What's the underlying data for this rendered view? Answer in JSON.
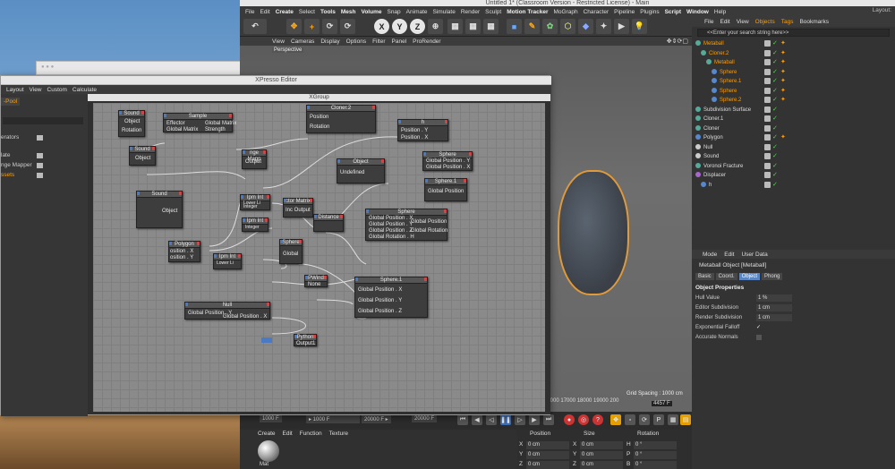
{
  "c4d": {
    "title": "Untitled 1* (Classroom Version - Restricted License) - Main",
    "menu": [
      "File",
      "Edit",
      "Create",
      "Select",
      "Tools",
      "Mesh",
      "Volume",
      "Snap",
      "Animate",
      "Simulate",
      "Render",
      "Sculpt",
      "Motion Tracker",
      "MoGraph",
      "Character",
      "Pipeline",
      "Plugins",
      "Script",
      "Window",
      "Help"
    ],
    "layout_label": "Layout:",
    "toolbar": {
      "x": "X",
      "y": "Y",
      "z": "Z"
    },
    "viewport_menu": [
      "View",
      "Cameras",
      "Display",
      "Options",
      "Filter",
      "Panel",
      "ProRender"
    ],
    "perspective": "Perspective",
    "grid_spacing": "Grid Spacing : 1000 cm",
    "timeline_ticks": "16000 17000 18000 19000 200",
    "timeline_frame": "4457 F",
    "frame_start": "1000 F",
    "frame_cur": "▸ 1000 F",
    "frame_end": "20000 F ▸",
    "frame_max": "20000 F"
  },
  "material": {
    "menu": [
      "Create",
      "Edit",
      "Function",
      "Texture"
    ],
    "label": "Mat"
  },
  "coords": {
    "headers": [
      "Position",
      "Size",
      "Rotation"
    ],
    "rows": [
      {
        "axis": "X",
        "pos": "0 cm",
        "size": "0 cm",
        "rot_axis": "H",
        "rot": "0 °"
      },
      {
        "axis": "Y",
        "pos": "0 cm",
        "size": "0 cm",
        "rot_axis": "P",
        "rot": "0 °"
      },
      {
        "axis": "Z",
        "pos": "0 cm",
        "size": "0 cm",
        "rot_axis": "B",
        "rot": "0 °"
      }
    ]
  },
  "objects": {
    "menu": [
      "File",
      "Edit",
      "View",
      "Objects",
      "Tags",
      "Bookmarks"
    ],
    "search_placeholder": "<<Enter your search string here>>",
    "items": [
      {
        "name": "Metaball",
        "indent": 0,
        "color": "#ff9d00",
        "icon": "#5a9"
      },
      {
        "name": "Cloner.2",
        "indent": 1,
        "color": "#ff9d00",
        "icon": "#5a9"
      },
      {
        "name": "Metaball",
        "indent": 2,
        "color": "#ff9d00",
        "icon": "#5a9"
      },
      {
        "name": "Sphere",
        "indent": 3,
        "color": "#ff9d00",
        "icon": "#58c"
      },
      {
        "name": "Sphere.1",
        "indent": 3,
        "color": "#ff9d00",
        "icon": "#58c"
      },
      {
        "name": "Sphere",
        "indent": 3,
        "color": "#ff9d00",
        "icon": "#58c"
      },
      {
        "name": "Sphere.2",
        "indent": 3,
        "color": "#ff9d00",
        "icon": "#58c"
      },
      {
        "name": "Subdivision Surface",
        "indent": 0,
        "color": "#ddd",
        "icon": "#5a9"
      },
      {
        "name": "Cloner.1",
        "indent": 0,
        "color": "#ddd",
        "icon": "#5a9"
      },
      {
        "name": "Cloner",
        "indent": 0,
        "color": "#ddd",
        "icon": "#5a9"
      },
      {
        "name": "Polygon",
        "indent": 0,
        "color": "#ddd",
        "icon": "#58c"
      },
      {
        "name": "Null",
        "indent": 0,
        "color": "#ddd",
        "icon": "#ccc"
      },
      {
        "name": "Sound",
        "indent": 0,
        "color": "#ddd",
        "icon": "#ccc"
      },
      {
        "name": "Voronoi Fracture",
        "indent": 0,
        "color": "#ddd",
        "icon": "#5a9"
      },
      {
        "name": "Displacer",
        "indent": 0,
        "color": "#ddd",
        "icon": "#a6c"
      },
      {
        "name": "h",
        "indent": 1,
        "color": "#ddd",
        "icon": "#58c"
      }
    ]
  },
  "attributes": {
    "menu": [
      "Mode",
      "Edit",
      "User Data"
    ],
    "title": "Metaball Object [Metaball]",
    "tabs": [
      "Basic",
      "Coord.",
      "Object",
      "Phong"
    ],
    "active_tab": "Object",
    "section": "Object Properties",
    "props": [
      {
        "label": "Hull Value",
        "value": "1 %"
      },
      {
        "label": "Editor Subdivision",
        "value": "1 cm"
      },
      {
        "label": "Render Subdivision",
        "value": "1 cm"
      },
      {
        "label": "Exponential Falloff",
        "value": "✓"
      },
      {
        "label": "Accurate Normals",
        "value": ""
      }
    ]
  },
  "xpresso": {
    "title": "XPresso Editor",
    "menu": [
      "Layout",
      "View",
      "Custom",
      "Calculate"
    ],
    "pool_tab": "-Pool",
    "pool_items": [
      {
        "label": "erators",
        "orange": false
      },
      {
        "label": "late",
        "orange": false
      },
      {
        "label": "nge Mapper",
        "orange": false
      },
      {
        "label": "ssets",
        "orange": true
      }
    ],
    "group": "XGroup",
    "nodes": {
      "sound1": {
        "title": "Sound",
        "p1": "Object",
        "p2": "Rotation"
      },
      "sample": {
        "title": "Sample",
        "p1": "Effector",
        "p2": "Global Matrix",
        "p3": "Global Matrix",
        "p4": "Strength"
      },
      "cloner2": {
        "title": "Cloner.2",
        "p1": "Position",
        "p2": "Rotation"
      },
      "h": {
        "title": "h",
        "p1": "Position . Y",
        "p2": "Position . X"
      },
      "sound2": {
        "title": "Sound",
        "p1": "Object"
      },
      "rangemap": {
        "title": "nge Mapp",
        "p1": "Output"
      },
      "object": {
        "title": "Object",
        "p1": "Undefined"
      },
      "sphere_a": {
        "title": "Sphere",
        "p1": "Global Position . Y",
        "p2": "Global Position . X"
      },
      "sound3": {
        "title": "Sound",
        "p1": "Object"
      },
      "sphere1a": {
        "title": "Sphere.1",
        "p1": "Global Position"
      },
      "mathint1": {
        "title": "Ipm Int",
        "p1": "Lower Li",
        "p2": "Integer",
        "p3": "Random"
      },
      "matrix": {
        "title": "ctor Matrix",
        "p1": "Inc Output"
      },
      "distance": {
        "title": "Distance"
      },
      "sphere_b": {
        "title": "Sphere",
        "p1": "Global Position . X",
        "p2": "Global Position",
        "p3": "Global Position . Y",
        "p4": "Global Rotation",
        "p5": "Global Position . Z",
        "p6": "Global Rotation . H"
      },
      "mathint2": {
        "title": "Ipm Int",
        "p1": "Lower Li",
        "p2": "Integer",
        "p3": "Random"
      },
      "polygon": {
        "title": "Polygon",
        "p1": "osition . X",
        "p2": "osition . Y"
      },
      "sphere_c": {
        "title": "Sphere",
        "p1": "Global"
      },
      "mathint3": {
        "title": "Ipm Int",
        "p1": "Lower Li",
        "p2": "Integer",
        "p3": "Random"
      },
      "pwind": {
        "title": "PWind",
        "p1": "None"
      },
      "sphere1b": {
        "title": "Sphere.1",
        "p1": "Global Position . X",
        "p2": "Global Position . Y",
        "p3": "Global Position . Z"
      },
      "null": {
        "title": "Null",
        "p1": "Global Position . Y",
        "p2": "Global Position . Z",
        "p3": "Global Position . X",
        "p4": "Null"
      },
      "python": {
        "title": "Python",
        "p1": "Input1",
        "p2": "Output1"
      }
    }
  }
}
